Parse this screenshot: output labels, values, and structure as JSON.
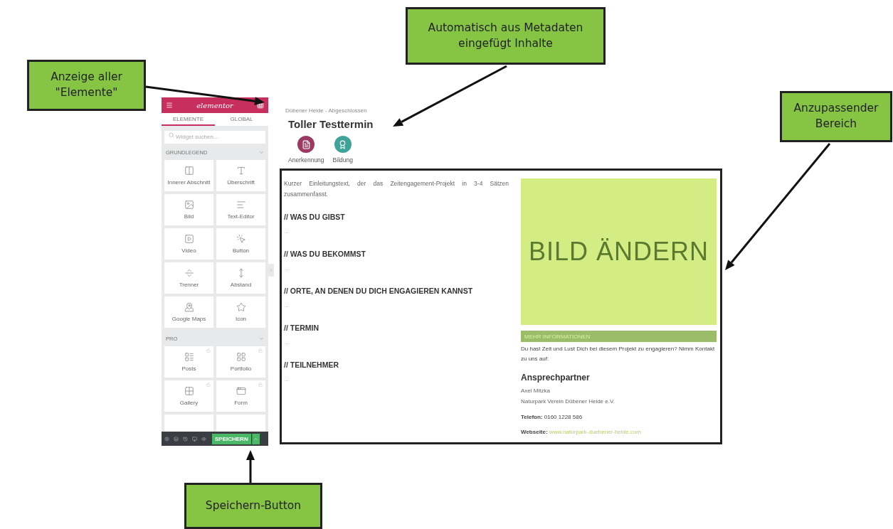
{
  "callouts": [
    {
      "text": "Anzeige aller\n\"Elemente\""
    },
    {
      "text": "Automatisch aus Metadaten\neingefügt Inhalte"
    },
    {
      "text": "Anzupassender\nBereich"
    },
    {
      "text": "Speichern-Button"
    }
  ],
  "editor_panel": {
    "logo": "elementor",
    "tabs": [
      {
        "label": "ELEMENTE",
        "selected": true
      },
      {
        "label": "GLOBAL",
        "selected": false
      }
    ],
    "search": {
      "placeholder": "Widget suchen..."
    },
    "sections": [
      {
        "title": "GRUNDLEGEND",
        "widgets": [
          {
            "label": "Innerer Abschnitt",
            "locked": false
          },
          {
            "label": "Überschrift",
            "locked": false
          },
          {
            "label": "Bild",
            "locked": false
          },
          {
            "label": "Text-Editor",
            "locked": false
          },
          {
            "label": "Video",
            "locked": false
          },
          {
            "label": "Button",
            "locked": false
          },
          {
            "label": "Trenner",
            "locked": false
          },
          {
            "label": "Abstand",
            "locked": false
          },
          {
            "label": "Google Maps",
            "locked": false
          },
          {
            "label": "Icon",
            "locked": false
          }
        ]
      },
      {
        "title": "PRO",
        "widgets": [
          {
            "label": "Posts",
            "locked": true
          },
          {
            "label": "Portfolio",
            "locked": true
          },
          {
            "label": "Gallery",
            "locked": true
          },
          {
            "label": "Form",
            "locked": true
          }
        ]
      }
    ],
    "save_button": "SPEICHERN"
  },
  "page": {
    "breadcrumb": "Dübener Heide - Abgeschlossen",
    "title": "Toller Testtermin",
    "categories": [
      {
        "label": "Anerkennung",
        "color": "#9c3a63"
      },
      {
        "label": "Bildung",
        "color": "#3fa39a"
      }
    ],
    "intro": "Kurzer Einleitungstext, der das Zeitengagement-Projekt in 3-4 Sätzen zusammenfasst.",
    "sections": [
      {
        "heading": "// WAS DU GIBST",
        "body": "..."
      },
      {
        "heading": "// WAS DU BEKOMMST",
        "body": "..."
      },
      {
        "heading": "// ORTE, AN DENEN DU DICH ENGAGIEREN KANNST",
        "body": "..."
      },
      {
        "heading": "// TERMIN",
        "body": "..."
      },
      {
        "heading": "// TEILNEHMER",
        "body": "..."
      }
    ],
    "image_placeholder": "BILD ÄNDERN",
    "info_bar": "MEHR INFORMATIONEN",
    "info_text": "Du hast Zeit und Lust Dich bei diesem Projekt zu engagieren? Nimm Kontakt zu uns auf:",
    "contact_heading": "Ansprechpartner",
    "contact_name": "Axel Mitzka",
    "contact_org": "Naturpark Verein Dübener Heide e.V.",
    "phone_label": "Telefon:",
    "phone": "0160 1228 586",
    "website_label": "Webseite:",
    "website": "www.naturpark-duebener-heide.com"
  }
}
